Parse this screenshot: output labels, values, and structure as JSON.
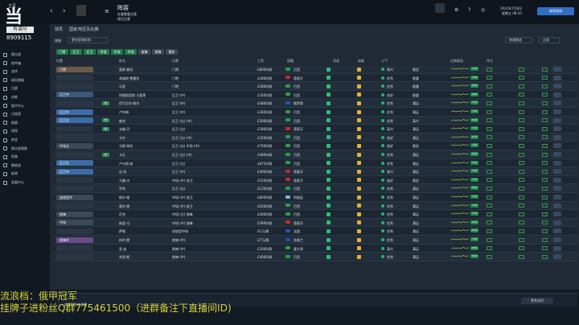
{
  "topbar": {
    "home_label": "主页",
    "section_title": "阵容",
    "subtitle_line1": "在最需要注意",
    "subtitle_line2": "球员注意",
    "date": "2022年7月8日",
    "weekday": "星期五 08:10",
    "continue_label": "继续游戏"
  },
  "logo": {
    "char": "当",
    "caption": "有调号",
    "id": "8909115"
  },
  "sidebar": {
    "items": [
      {
        "label": "俱乐部"
      },
      {
        "label": "收件箱"
      },
      {
        "label": "战术"
      },
      {
        "label": "球队数据"
      },
      {
        "label": "比赛"
      },
      {
        "label": "训练"
      },
      {
        "label": "医疗中心"
      },
      {
        "label": "日程表"
      },
      {
        "label": "联赛"
      },
      {
        "label": "球探"
      },
      {
        "label": "转会"
      },
      {
        "label": "俱乐部视野"
      },
      {
        "label": "财政"
      },
      {
        "label": "教练部"
      },
      {
        "label": "新闻"
      },
      {
        "label": "发展中心"
      }
    ]
  },
  "subtabs": {
    "t1": "球员",
    "t2": "国家/地区队比赛"
  },
  "filter": {
    "label": "视图",
    "dropdown": "更衣室和形势",
    "quick_pick": "快速挑选",
    "filter": "过滤",
    "buttons": [
      "门将",
      "后卫",
      "后卫",
      "中场",
      "中场",
      "中场",
      "前锋",
      "前锋",
      "替补"
    ]
  },
  "columns": {
    "pos": "位置",
    "name": "姓名",
    "position": "位置",
    "value": "工资",
    "nation": "国籍",
    "status": "状态",
    "morale": "士气",
    "fitness": "体能",
    "form": "近期表现",
    "rating": "评分"
  },
  "rows": [
    {
      "pos": "门将",
      "posc": "#6b5a4a",
      "tag": "",
      "name": "奥斯·普切",
      "position": "门将",
      "value": "£8000/周",
      "nation": "巴西",
      "flag": "#2a9d4a",
      "dot": "#27b46b",
      "morale": "高兴",
      "mental": "稳定",
      "rating": "7.20"
    },
    {
      "pos": "",
      "posc": "",
      "tag": "",
      "name": "李维斯·费雷拉",
      "position": "门将",
      "value": "£2800/周",
      "nation": "葡萄牙",
      "flag": "#c22b2b",
      "dot": "#27b46b",
      "morale": "优秀",
      "mental": "稳重",
      "rating": "7.00"
    },
    {
      "pos": "",
      "posc": "",
      "tag": "",
      "name": "马里",
      "position": "门将",
      "value": "£2800/周",
      "nation": "巴西",
      "flag": "#2a9d4a",
      "dot": "#27b46b",
      "morale": "优秀",
      "mental": "稳重",
      "rating": "6.90"
    },
    {
      "pos": "后卫中",
      "posc": "#3b5a7a",
      "tag": "",
      "name": "阿格斯塔斯·马奥莱",
      "position": "后卫 (中)",
      "value": "£3500/周",
      "nation": "巴西",
      "flag": "#2a9d4a",
      "dot": "#27b46b",
      "morale": "良好",
      "mental": "稳重",
      "rating": "6.80"
    },
    {
      "pos": "",
      "posc": "",
      "tag": "伤",
      "name": "伊万尼尔·佩尔",
      "position": "后卫 (中)",
      "value": "£4800/周",
      "nation": "俄罗斯",
      "flag": "#2c4fa3",
      "dot": "#27b46b",
      "morale": "优秀",
      "mental": "满足",
      "rating": "7.10"
    },
    {
      "pos": "后卫中",
      "posc": "#3c6da8",
      "tag": "",
      "name": "卢尔梅",
      "position": "后卫 (中)",
      "value": "£3600/周",
      "nation": "巴西",
      "flag": "#2a9d4a",
      "dot": "#27b46b",
      "morale": "优秀",
      "mental": "满足",
      "rating": "7.00"
    },
    {
      "pos": "后卫左",
      "posc": "#3c6da8",
      "tag": "伤",
      "name": "维克",
      "position": "后卫 (右) (中)",
      "value": "£3000/周",
      "nation": "巴西",
      "flag": "#2a9d4a",
      "dot": "#27b46b",
      "morale": "优秀",
      "mental": "高兴",
      "rating": "6.90"
    },
    {
      "pos": "",
      "posc": "",
      "tag": "伤",
      "name": "法维·巴",
      "position": "后卫 (左)",
      "value": "£3900/周",
      "nation": "葡萄牙",
      "flag": "#c22b2b",
      "dot": "#27b46b",
      "morale": "高兴",
      "mental": "满足",
      "rating": "7.30"
    },
    {
      "pos": "",
      "posc": "",
      "tag": "",
      "name": "卡尔",
      "position": "后卫 (右) (中)",
      "value": "£3200/周",
      "nation": "巴西",
      "flag": "#2a9d4a",
      "dot": "#27b46b",
      "morale": "良好",
      "mental": "满足",
      "rating": "6.70"
    },
    {
      "pos": "中场左",
      "posc": "#3b4a5a",
      "tag": "",
      "name": "马斯·特伦",
      "position": "后卫 (右) 中场 (中)",
      "value": "£7000/周",
      "nation": "巴西",
      "flag": "#2a9d4a",
      "dot": "#27b46b",
      "morale": "很好",
      "mental": "稳定",
      "rating": "7.40"
    },
    {
      "pos": "",
      "posc": "",
      "tag": "伤",
      "name": "卡扎",
      "position": "后卫 (右) (中)",
      "value": "£4800/周",
      "nation": "巴西",
      "flag": "#2a9d4a",
      "dot": "#27b46b",
      "morale": "优秀",
      "mental": "满足",
      "rating": "6.90"
    },
    {
      "pos": "后卫左",
      "posc": "#3c6da8",
      "tag": "",
      "name": "卢卡斯·席",
      "position": "后卫 (左)",
      "value": "£8750/周",
      "nation": "巴西",
      "flag": "#2a9d4a",
      "dot": "#27b46b",
      "morale": "优秀",
      "mental": "满足",
      "rating": "7.10"
    },
    {
      "pos": "后卫中",
      "posc": "#3c6da8",
      "tag": "",
      "name": "达·科",
      "position": "后卫 (中)",
      "value": "£4000/周",
      "nation": "葡萄牙",
      "flag": "#c22b2b",
      "dot": "#27b46b",
      "morale": "高兴",
      "mental": "满足",
      "rating": "7.00"
    },
    {
      "pos": "",
      "posc": "",
      "tag": "",
      "name": "马鲁·内",
      "position": "中场 (中) 前卫",
      "value": "£5200/周",
      "nation": "葡萄牙",
      "flag": "#c22b2b",
      "dot": "#27b46b",
      "morale": "极好",
      "mental": "稳定",
      "rating": "7.30"
    },
    {
      "pos": "",
      "posc": "",
      "tag": "",
      "name": "乔利",
      "position": "后卫 (右)",
      "value": "£1200/周",
      "nation": "巴西",
      "flag": "#2a9d4a",
      "dot": "#27b46b",
      "morale": "优秀",
      "mental": "满足",
      "rating": "6.60"
    },
    {
      "pos": "进攻型中",
      "posc": "#3b4a5a",
      "tag": "",
      "name": "佩尔·格",
      "position": "中场 (中) 前卫",
      "value": "£8000/周",
      "nation": "阿根廷",
      "flag": "#7fb0e0",
      "dot": "#27b46b",
      "morale": "优秀",
      "mental": "满足",
      "rating": "7.20"
    },
    {
      "pos": "",
      "posc": "",
      "tag": "",
      "name": "奥尔·德",
      "position": "中场 (中) 前卫",
      "value": "£6200/周",
      "nation": "巴西",
      "flag": "#2a9d4a",
      "dot": "#27b46b",
      "morale": "优秀",
      "mental": "满足",
      "rating": "7.00"
    },
    {
      "pos": "前锋",
      "posc": "#3b4a5a",
      "tag": "",
      "name": "尼克",
      "position": "中场 (左) 前锋",
      "value": "£4000/周",
      "nation": "巴西",
      "flag": "#2a9d4a",
      "dot": "#27b46b",
      "morale": "优秀",
      "mental": "满足",
      "rating": "7.10"
    },
    {
      "pos": "中场",
      "posc": "#3b4a5a",
      "tag": "",
      "name": "纳里·马",
      "position": "中场 (中) 前锋",
      "value": "£3900/周",
      "nation": "葡萄牙",
      "flag": "#c22b2b",
      "dot": "#27b46b",
      "morale": "优秀",
      "mental": "满足",
      "rating": "6.90"
    },
    {
      "pos": "",
      "posc": "",
      "tag": "",
      "name": "萨格",
      "position": "进攻型中场",
      "value": "£1万/周",
      "nation": "法国",
      "flag": "#2b4fb0",
      "dot": "#27b46b",
      "morale": "优秀",
      "mental": "满足",
      "rating": "6.90"
    },
    {
      "pos": "前锋中",
      "posc": "#6b4a8a",
      "tag": "",
      "name": "科尔·蒙",
      "position": "前锋 (中)",
      "value": "£7万/周",
      "nation": "苏格兰",
      "flag": "#1c4fa3",
      "dot": "#27b46b",
      "morale": "优秀",
      "mental": "满足",
      "rating": "7.40"
    },
    {
      "pos": "",
      "posc": "",
      "tag": "",
      "name": "里·迪",
      "position": "前锋 (中)",
      "value": "£2000/周",
      "nation": "意大利",
      "flag": "#2a9d4a",
      "dot": "#27b46b",
      "morale": "高兴",
      "mental": "满足",
      "rating": "6.80"
    },
    {
      "pos": "",
      "posc": "",
      "tag": "",
      "name": "克里·斯",
      "position": "前锋 (中)",
      "value": "£4000/周",
      "nation": "巴西",
      "flag": "#2a9d4a",
      "dot": "#27b46b",
      "morale": "优秀",
      "mental": "满足",
      "rating": "6.90"
    }
  ],
  "overlay": {
    "line1": "流浪档：俄甲冠军",
    "line2": "挂牌子进粉丝Q群775461500（进群备注下直播间ID)"
  },
  "statusbar": {
    "text": "选择球员并查看",
    "right_button": "更多选项"
  }
}
